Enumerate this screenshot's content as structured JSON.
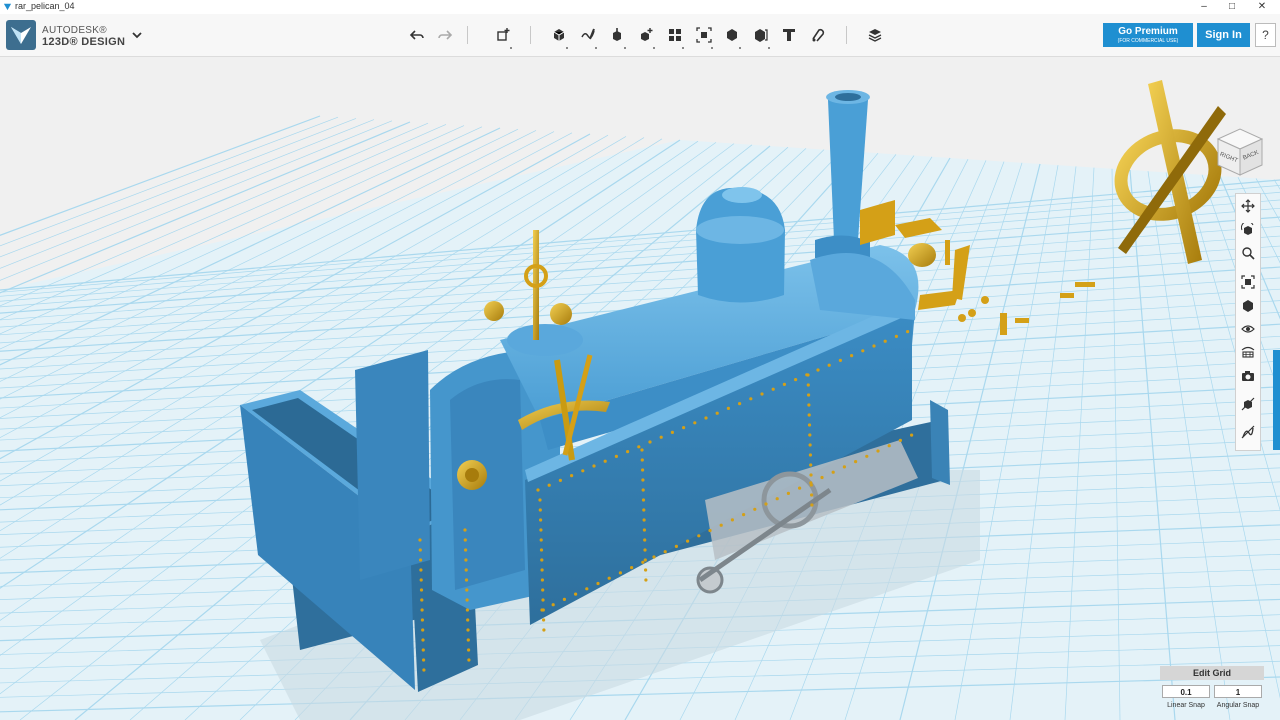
{
  "window": {
    "title": "rar_pelican_04",
    "controls": [
      "minimize",
      "maximize",
      "close"
    ]
  },
  "brand": {
    "line1": "AUTODESK®",
    "line2": "123D® DESIGN"
  },
  "toolbar": {
    "tools": [
      "undo-icon",
      "redo-icon",
      "transform-icon",
      "primitives-icon",
      "sketch-icon",
      "construct-icon",
      "modify-icon",
      "pattern-icon",
      "grouping-icon",
      "combine-icon",
      "measure-icon",
      "text-icon",
      "snap-icon",
      "materials-icon"
    ],
    "premium_label": "Go Premium",
    "premium_sub": "(FOR COMMERCIAL USE)",
    "signin_label": "Sign In",
    "help_label": "?"
  },
  "viewcube": {
    "face_right": "RIGHT",
    "face_back": "BACK"
  },
  "navigation": {
    "tools": [
      "pan-icon",
      "orbit-icon",
      "zoom-icon",
      "fit-icon",
      "view-icon",
      "visibility-icon",
      "materials-view-icon",
      "camera-icon",
      "show-hide-icon",
      "sketch-visibility-icon"
    ]
  },
  "grid": {
    "edit_label": "Edit Grid",
    "linear_snap_value": "0.1",
    "angular_snap_value": "1",
    "linear_snap_label": "Linear Snap",
    "angular_snap_label": "Angular Snap"
  },
  "colors": {
    "accent": "#1f8fd1",
    "model_blue": "#4a9fd6",
    "brass": "#d4a017",
    "grid_line": "#9fd3ec"
  }
}
